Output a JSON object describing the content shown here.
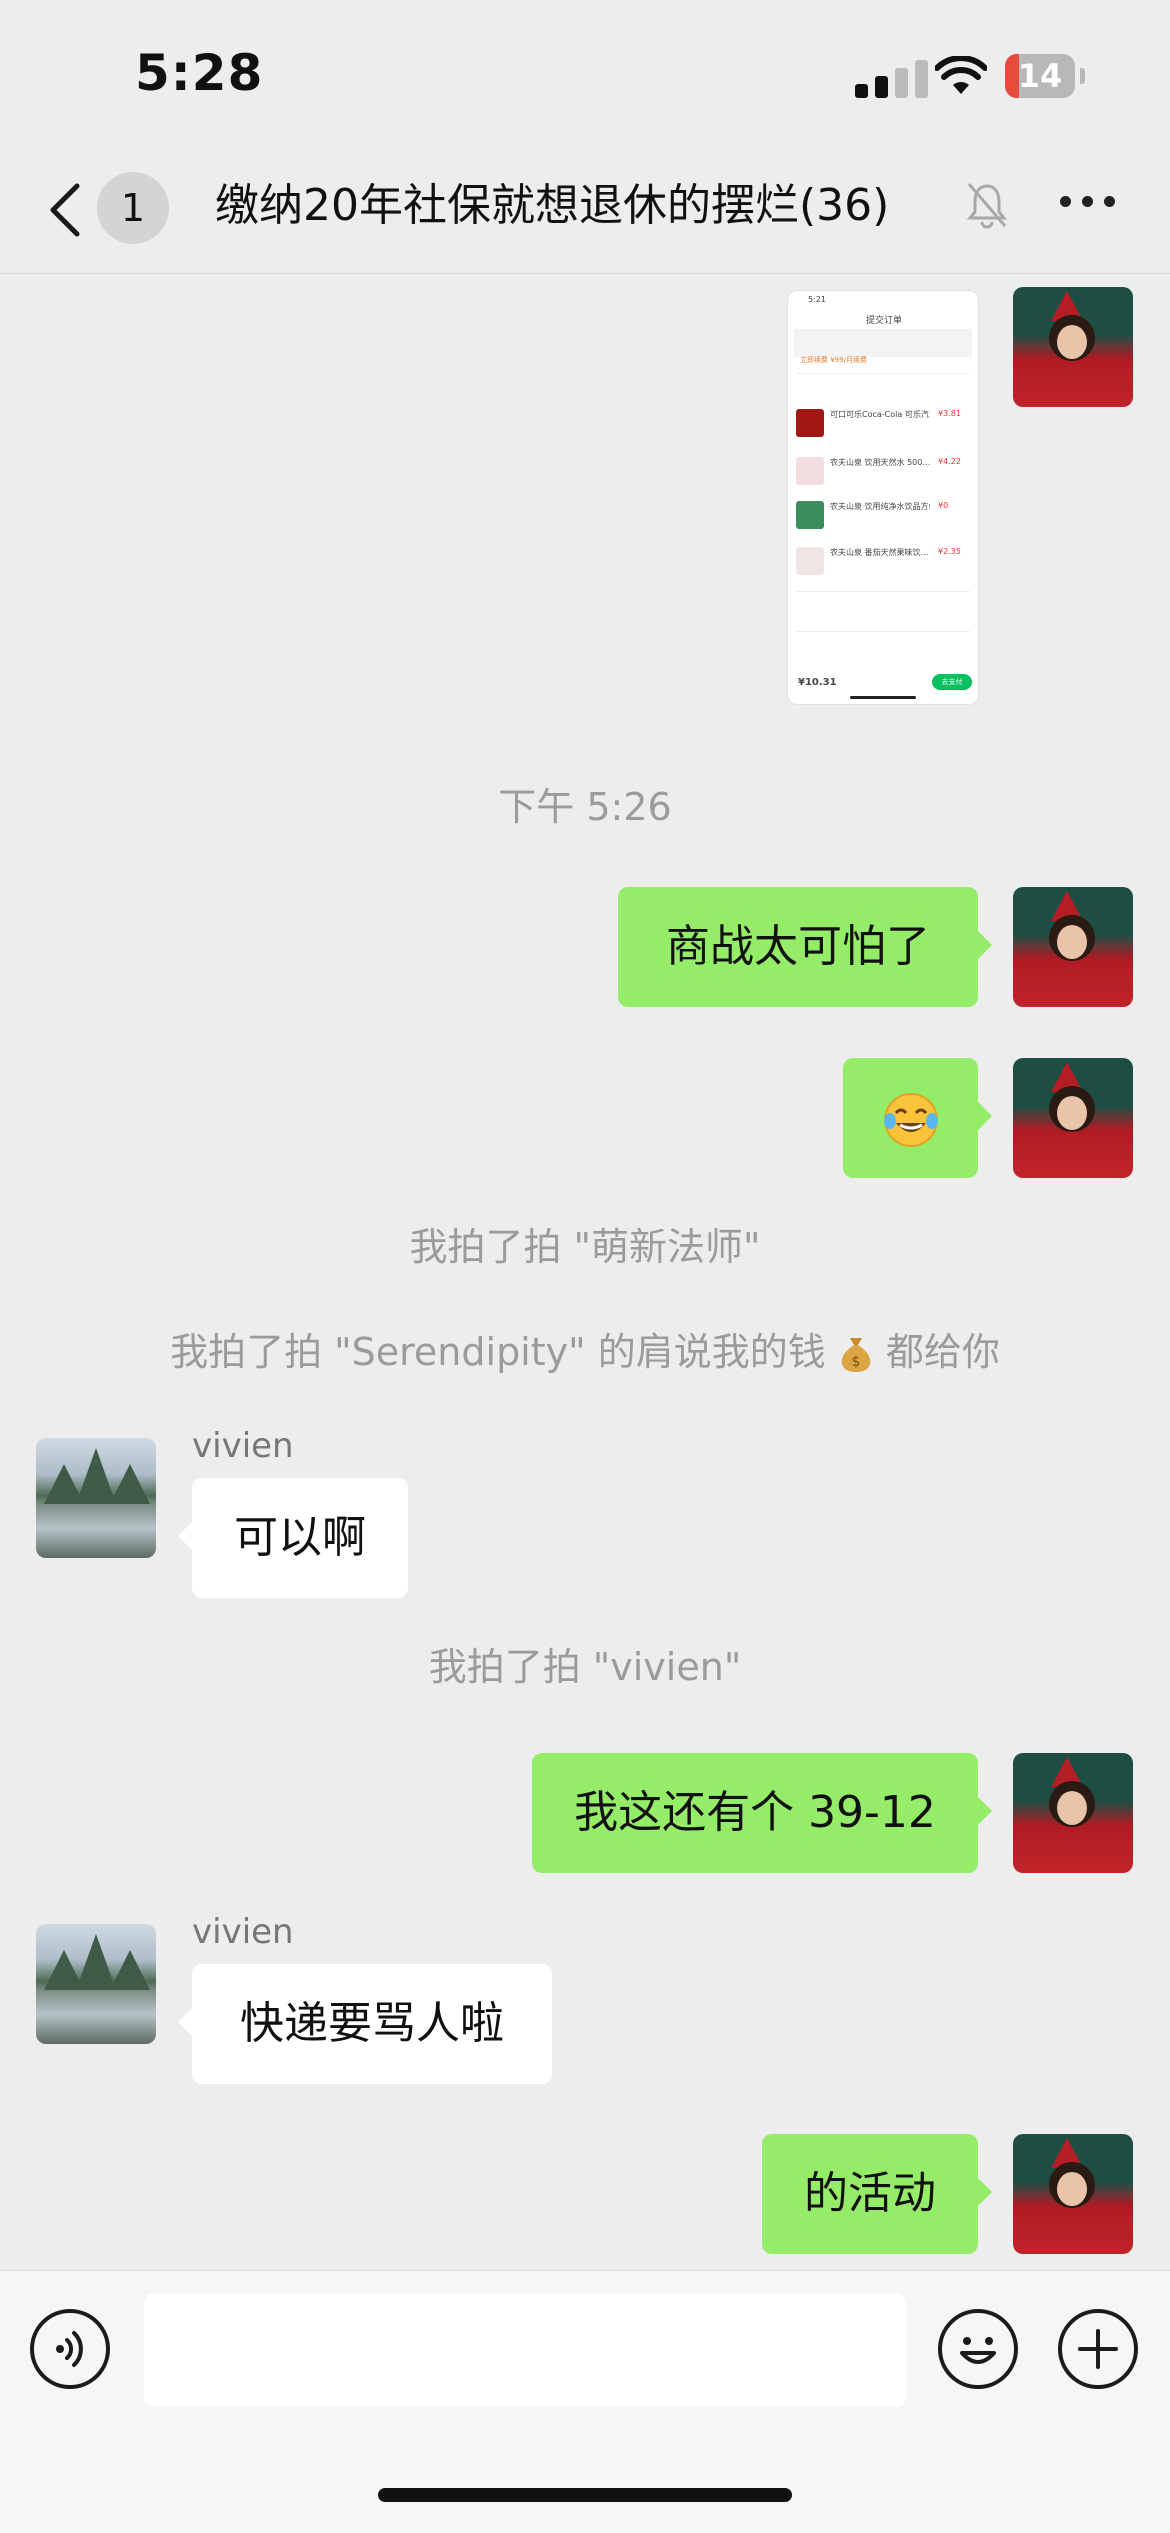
{
  "status_bar": {
    "time": "5:28",
    "battery": "14"
  },
  "nav": {
    "unread_count": "1",
    "title": "缴纳20年社保就想退休的摆烂(36)"
  },
  "shared_screenshot": {
    "time": "5:21",
    "header": "提交订单",
    "items": [
      "可口可乐Coca-Cola 可乐汽…",
      "农夫山泉 饮用天然水 500…",
      "农夫山泉 饮用纯净水饮品方便…",
      "农夫山泉 番茄天然果味饮…"
    ],
    "prices": [
      "¥3.81",
      "¥4.22",
      "¥0",
      "¥2.35"
    ],
    "total": "¥10.31",
    "btn": "去支付"
  },
  "messages": {
    "time_divider": "下午 5:26",
    "m1": "商战太可怕了",
    "sys1": "我拍了拍 \"萌新法师\"",
    "sys2_a": "我拍了拍 \"Serendipity\" 的肩说我的钱",
    "sys2_b": "都给你",
    "sender1": "vivien",
    "m3": "可以啊",
    "sys3": "我拍了拍 \"vivien\"",
    "m4": "我这还有个 39-12",
    "sender2": "vivien",
    "m5": "快递要骂人啦",
    "m6": "的活动"
  },
  "colors": {
    "my_bubble": "#95ec69",
    "their_bubble": "#ffffff",
    "background": "#ededed"
  }
}
